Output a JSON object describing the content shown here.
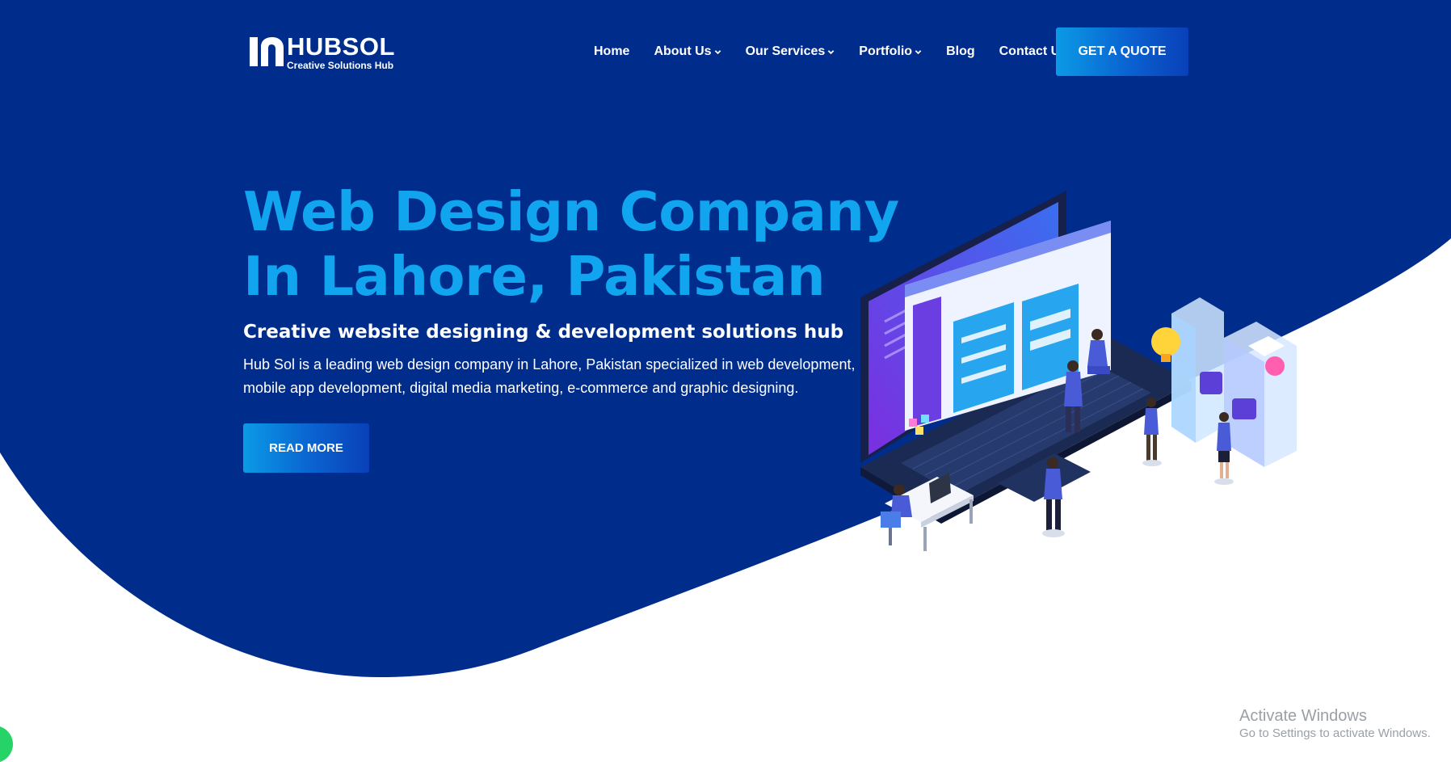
{
  "colors": {
    "hero_navy": "#002d8c",
    "title_blue": "#12a5ef",
    "button_gradient_start": "#0b9ae6",
    "button_gradient_end": "#0940b8",
    "whatsapp_green": "#25d366"
  },
  "header": {
    "logo": {
      "name": "HUBSOL",
      "tagline": "Creative Solutions Hub",
      "icon": "hubsol-logo-icon"
    },
    "nav": [
      {
        "label": "Home",
        "has_dropdown": false
      },
      {
        "label": "About Us",
        "has_dropdown": true
      },
      {
        "label": "Our Services",
        "has_dropdown": true
      },
      {
        "label": "Portfolio",
        "has_dropdown": true
      },
      {
        "label": "Blog",
        "has_dropdown": false
      },
      {
        "label": "Contact Us",
        "has_dropdown": false
      }
    ],
    "cta_label": "GET A QUOTE"
  },
  "hero": {
    "title_line1": "Web Design Company",
    "title_line2": "In Lahore, Pakistan",
    "subtitle": "Creative website designing & development solutions hub",
    "description": "Hub Sol is a leading web design company in Lahore, Pakistan specialized in web development, mobile app development, digital media marketing, e-commerce and graphic designing.",
    "button_label": "READ MORE",
    "illustration": "isometric-laptop-team-ux-illustration"
  },
  "floating": {
    "chat_icon": "whatsapp-icon"
  },
  "watermark": {
    "title": "Activate Windows",
    "subtitle": "Go to Settings to activate Windows."
  }
}
